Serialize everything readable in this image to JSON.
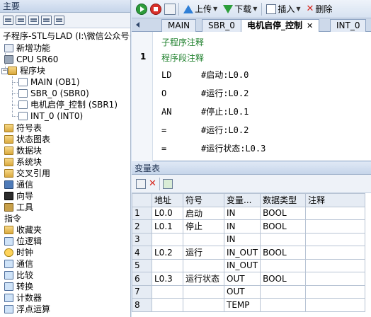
{
  "left_panel": {
    "title": "主要",
    "project_title": "子程序-STL与LAD (I:\\微信公众号·",
    "items": [
      {
        "label": "新增功能"
      },
      {
        "label": "CPU SR60"
      },
      {
        "label": "程序块"
      },
      {
        "label": "MAIN (OB1)"
      },
      {
        "label": "SBR_0 (SBR0)"
      },
      {
        "label": "电机启停_控制 (SBR1)"
      },
      {
        "label": "INT_0 (INT0)"
      },
      {
        "label": "符号表"
      },
      {
        "label": "状态图表"
      },
      {
        "label": "数据块"
      },
      {
        "label": "系统块"
      },
      {
        "label": "交叉引用"
      },
      {
        "label": "通信"
      },
      {
        "label": "向导"
      },
      {
        "label": "工具"
      },
      {
        "label": "指令"
      },
      {
        "label": "收藏夹"
      },
      {
        "label": "位逻辑"
      },
      {
        "label": "时钟"
      },
      {
        "label": "通信"
      },
      {
        "label": "比较"
      },
      {
        "label": "转换"
      },
      {
        "label": "计数器"
      },
      {
        "label": "浮点运算"
      }
    ]
  },
  "toolbar": {
    "upload_label": "上传",
    "download_label": "下载",
    "insert_label": "插入",
    "delete_label": "删除"
  },
  "tabs": [
    {
      "label": "MAIN"
    },
    {
      "label": "SBR_0"
    },
    {
      "label": "电机启停_控制"
    },
    {
      "label": "INT_0"
    }
  ],
  "editor": {
    "subroutine_comment": "子程序注释",
    "network_number": "1",
    "network_comment": "程序段注释",
    "lines": [
      {
        "op": "LD",
        "operand": "#启动:L0.0"
      },
      {
        "op": "O",
        "operand": "#运行:L0.2"
      },
      {
        "op": "AN",
        "operand": "#停止:L0.1"
      },
      {
        "op": "=",
        "operand": "#运行:L0.2"
      },
      {
        "op": "=",
        "operand": "#运行状态:L0.3"
      }
    ]
  },
  "variables": {
    "title": "变量表",
    "columns": [
      "地址",
      "符号",
      "变量...",
      "数据类型",
      "注释"
    ],
    "rows": [
      {
        "n": "1",
        "addr": "L0.0",
        "sym": "启动",
        "vtype": "IN",
        "dtype": "BOOL",
        "comment": ""
      },
      {
        "n": "2",
        "addr": "L0.1",
        "sym": "停止",
        "vtype": "IN",
        "dtype": "BOOL",
        "comment": ""
      },
      {
        "n": "3",
        "addr": "",
        "sym": "",
        "vtype": "IN",
        "dtype": "",
        "comment": ""
      },
      {
        "n": "4",
        "addr": "L0.2",
        "sym": "运行",
        "vtype": "IN_OUT",
        "dtype": "BOOL",
        "comment": ""
      },
      {
        "n": "5",
        "addr": "",
        "sym": "",
        "vtype": "IN_OUT",
        "dtype": "",
        "comment": ""
      },
      {
        "n": "6",
        "addr": "L0.3",
        "sym": "运行状态",
        "vtype": "OUT",
        "dtype": "BOOL",
        "comment": ""
      },
      {
        "n": "7",
        "addr": "",
        "sym": "",
        "vtype": "OUT",
        "dtype": "",
        "comment": ""
      },
      {
        "n": "8",
        "addr": "",
        "sym": "",
        "vtype": "TEMP",
        "dtype": "",
        "comment": ""
      }
    ]
  },
  "colors": {
    "comment_green": "#1c7f2a",
    "accent_blue": "#2f7fd6"
  }
}
